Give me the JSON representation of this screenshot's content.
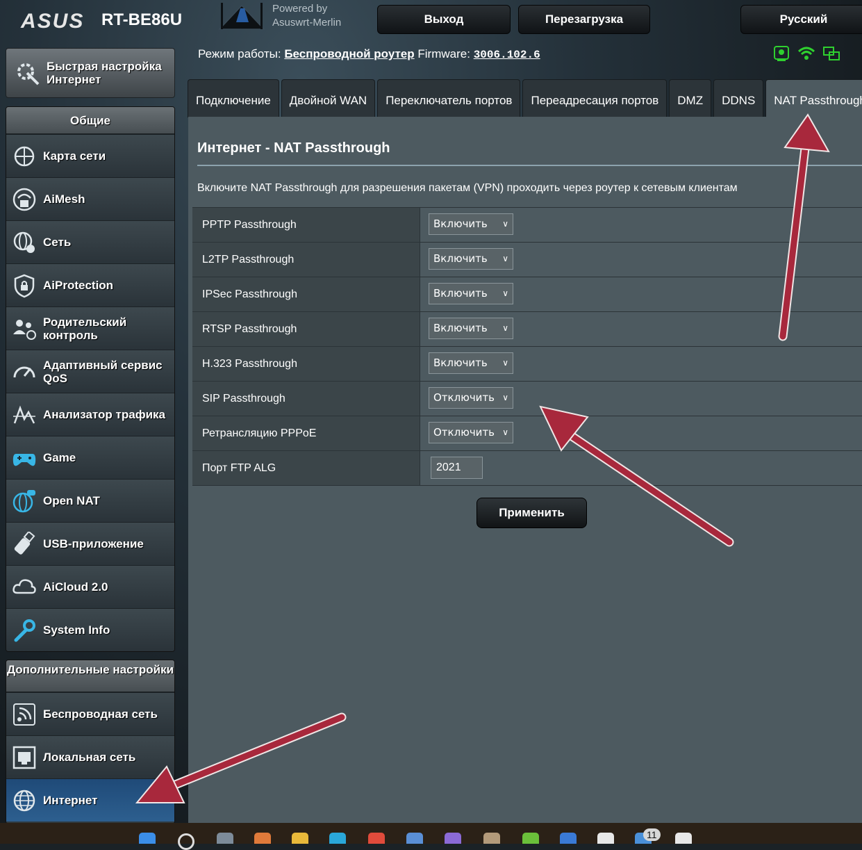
{
  "header": {
    "brand": "ASUS",
    "model": "RT-BE86U",
    "powered_by_line1": "Powered by",
    "powered_by_line2": "Asuswrt-Merlin",
    "logout": "Выход",
    "reboot": "Перезагрузка",
    "language": "Русский"
  },
  "status": {
    "mode_label": "Режим работы:",
    "mode_value": "Беспроводной роутер",
    "firmware_label": "Firmware:",
    "firmware_value": "3006.102.6"
  },
  "sidebar": {
    "quick_setup": "Быстрая настройка Интернет",
    "general_header": "Общие",
    "general_items": [
      {
        "label": "Карта сети",
        "icon": "network-map-icon"
      },
      {
        "label": "AiMesh",
        "icon": "aimesh-icon"
      },
      {
        "label": "Сеть",
        "icon": "globe-network-icon"
      },
      {
        "label": "AiProtection",
        "icon": "shield-lock-icon"
      },
      {
        "label": "Родительский контроль",
        "icon": "parental-control-icon"
      },
      {
        "label": "Адаптивный сервис QoS",
        "icon": "speedometer-icon"
      },
      {
        "label": "Анализатор трафика",
        "icon": "traffic-analyzer-icon"
      },
      {
        "label": "Game",
        "icon": "gamepad-icon"
      },
      {
        "label": "Open NAT",
        "icon": "open-nat-icon"
      },
      {
        "label": "USB-приложение",
        "icon": "usb-icon"
      },
      {
        "label": "AiCloud 2.0",
        "icon": "cloud-icon"
      },
      {
        "label": "System Info",
        "icon": "wrench-icon"
      }
    ],
    "advanced_header": "Дополнительные настройки",
    "advanced_items": [
      {
        "label": "Беспроводная сеть",
        "icon": "wireless-icon"
      },
      {
        "label": "Локальная сеть",
        "icon": "lan-icon"
      },
      {
        "label": "Интернет",
        "icon": "globe-icon"
      }
    ]
  },
  "tabs": [
    "Подключение",
    "Двойной WAN",
    "Переключатель портов",
    "Переадресация портов",
    "DMZ",
    "DDNS",
    "NAT Passthrough"
  ],
  "active_tab": "NAT Passthrough",
  "page": {
    "title": "Интернет - NAT Passthrough",
    "description": "Включите NAT Passthrough для разрешения пакетам (VPN) проходить через роутер к сетевым клиентам",
    "rows": [
      {
        "label": "PPTP Passthrough",
        "value": "Включить"
      },
      {
        "label": "L2TP Passthrough",
        "value": "Включить"
      },
      {
        "label": "IPSec Passthrough",
        "value": "Включить"
      },
      {
        "label": "RTSP Passthrough",
        "value": "Включить"
      },
      {
        "label": "H.323 Passthrough",
        "value": "Включить"
      },
      {
        "label": "SIP Passthrough",
        "value": "Отключить"
      },
      {
        "label": "Ретрансляцию PPPoE",
        "value": "Отключить"
      }
    ],
    "ftp_label": "Порт FTP ALG",
    "ftp_value": "2021",
    "apply": "Применить"
  },
  "taskbar": {
    "badge": "11"
  },
  "colors": {
    "content_bg": "#4d5a60",
    "label_bg": "#3b4549",
    "active_menu": "#2d5f8f",
    "annotation_arrow": "#a8283c",
    "status_green": "#2fd02f"
  }
}
